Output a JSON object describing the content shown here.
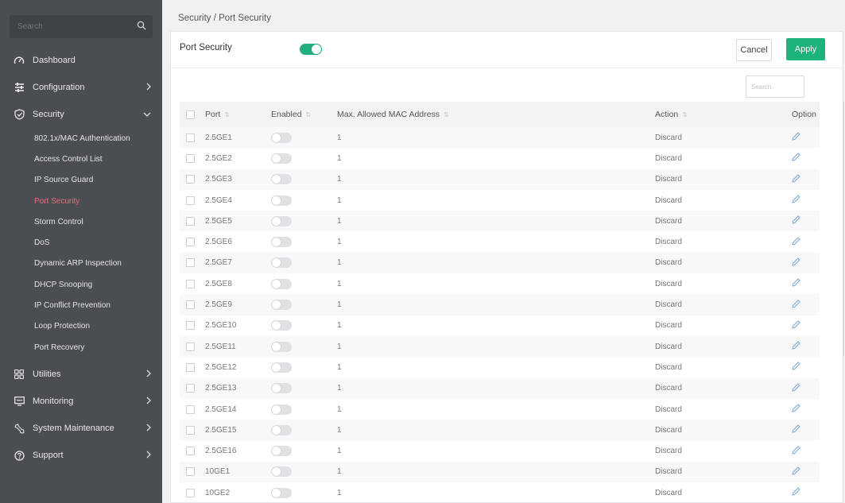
{
  "sidebar": {
    "search_placeholder": "Search",
    "items": [
      {
        "label": "Dashboard",
        "icon": "dashboard-icon"
      },
      {
        "label": "Configuration",
        "icon": "sliders-icon"
      },
      {
        "label": "Security",
        "icon": "shield-icon"
      },
      {
        "label": "Utilities",
        "icon": "grid-icon"
      },
      {
        "label": "Monitoring",
        "icon": "monitor-icon"
      },
      {
        "label": "System Maintenance",
        "icon": "wrench-icon"
      },
      {
        "label": "Support",
        "icon": "help-icon"
      }
    ],
    "security_subitems": [
      "802.1x/MAC Authentication",
      "Access Control List",
      "IP Source Guard",
      "Port Security",
      "Storm Control",
      "DoS",
      "Dynamic ARP Inspection",
      "DHCP Snooping",
      "IP Conflict Prevention",
      "Loop Protection",
      "Port Recovery"
    ],
    "active_subitem": "Port Security"
  },
  "breadcrumb": "Security / Port Security",
  "panel": {
    "title": "Port Security",
    "port_security_enabled": true,
    "cancel_label": "Cancel",
    "apply_label": "Apply",
    "search_placeholder": "Search"
  },
  "table": {
    "columns": [
      "Port",
      "Enabled",
      "Max. Allowed MAC Address",
      "Action",
      "Option"
    ],
    "rows": [
      {
        "port": "2.5GE1",
        "enabled": false,
        "max_mac": "1",
        "action": "Discard"
      },
      {
        "port": "2.5GE2",
        "enabled": false,
        "max_mac": "1",
        "action": "Discard"
      },
      {
        "port": "2.5GE3",
        "enabled": false,
        "max_mac": "1",
        "action": "Discard"
      },
      {
        "port": "2.5GE4",
        "enabled": false,
        "max_mac": "1",
        "action": "Discard"
      },
      {
        "port": "2.5GE5",
        "enabled": false,
        "max_mac": "1",
        "action": "Discard"
      },
      {
        "port": "2.5GE6",
        "enabled": false,
        "max_mac": "1",
        "action": "Discard"
      },
      {
        "port": "2.5GE7",
        "enabled": false,
        "max_mac": "1",
        "action": "Discard"
      },
      {
        "port": "2.5GE8",
        "enabled": false,
        "max_mac": "1",
        "action": "Discard"
      },
      {
        "port": "2.5GE9",
        "enabled": false,
        "max_mac": "1",
        "action": "Discard"
      },
      {
        "port": "2.5GE10",
        "enabled": false,
        "max_mac": "1",
        "action": "Discard"
      },
      {
        "port": "2.5GE11",
        "enabled": false,
        "max_mac": "1",
        "action": "Discard"
      },
      {
        "port": "2.5GE12",
        "enabled": false,
        "max_mac": "1",
        "action": "Discard"
      },
      {
        "port": "2.5GE13",
        "enabled": false,
        "max_mac": "1",
        "action": "Discard"
      },
      {
        "port": "2.5GE14",
        "enabled": false,
        "max_mac": "1",
        "action": "Discard"
      },
      {
        "port": "2.5GE15",
        "enabled": false,
        "max_mac": "1",
        "action": "Discard"
      },
      {
        "port": "2.5GE16",
        "enabled": false,
        "max_mac": "1",
        "action": "Discard"
      },
      {
        "port": "10GE1",
        "enabled": false,
        "max_mac": "1",
        "action": "Discard"
      },
      {
        "port": "10GE2",
        "enabled": false,
        "max_mac": "1",
        "action": "Discard"
      }
    ]
  },
  "colors": {
    "sidebar_bg": "#4a4d51",
    "accent_green": "#1cb47a",
    "active_item": "#e0727b"
  }
}
